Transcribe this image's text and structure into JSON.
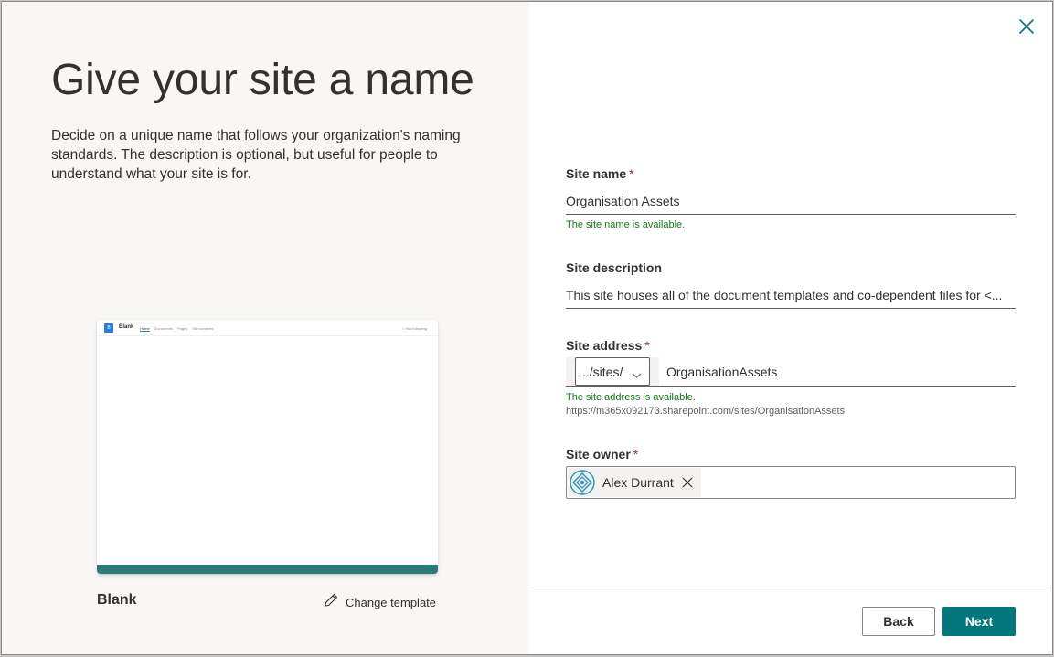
{
  "left": {
    "title": "Give your site a name",
    "intro": "Decide on a unique name that follows your organization's naming standards. The description is optional, but useful for people to understand what your site is for.",
    "preview": {
      "site_title": "Blank",
      "nav": [
        "Home",
        "Documents",
        "Pages",
        "Site contents"
      ],
      "follow": "☆ Not following",
      "logo_letter": "B"
    },
    "template_name": "Blank",
    "change_template": "Change template"
  },
  "form": {
    "site_name": {
      "label": "Site name",
      "required": "*",
      "value": "Organisation Assets",
      "status": "The site name is available."
    },
    "site_description": {
      "label": "Site description",
      "value": "This site houses all of the document templates and co-dependent files for <..."
    },
    "site_address": {
      "label": "Site address",
      "required": "*",
      "prefix": "../sites/",
      "value": "OrganisationAssets",
      "status": "The site address is available.",
      "url": "https://m365x092173.sharepoint.com/sites/OrganisationAssets"
    },
    "site_owner": {
      "label": "Site owner",
      "required": "*",
      "owner_name": "Alex Durrant"
    }
  },
  "buttons": {
    "back": "Back",
    "next": "Next"
  },
  "colors": {
    "accent": "#03787c",
    "success": "#107c10",
    "required": "#a4262c",
    "card_footer": "#2a7b78"
  },
  "icons": {
    "close": "close-icon",
    "pencil": "pencil-icon",
    "chevron": "chevron-down-icon",
    "avatar": "avatar-icon",
    "remove": "remove-icon"
  }
}
